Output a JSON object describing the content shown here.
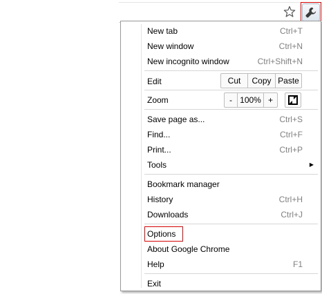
{
  "toolbar": {
    "star_icon": "star-icon",
    "wrench_icon": "wrench-icon",
    "highlight_color": "#d40000"
  },
  "menu": {
    "new_tab": {
      "label": "New tab",
      "shortcut": "Ctrl+T"
    },
    "new_window": {
      "label": "New window",
      "shortcut": "Ctrl+N"
    },
    "new_incognito": {
      "label": "New incognito window",
      "shortcut": "Ctrl+Shift+N"
    },
    "edit": {
      "label": "Edit",
      "cut": "Cut",
      "copy": "Copy",
      "paste": "Paste"
    },
    "zoom": {
      "label": "Zoom",
      "minus": "-",
      "level": "100%",
      "plus": "+"
    },
    "save_page": {
      "label": "Save page as...",
      "shortcut": "Ctrl+S"
    },
    "find": {
      "label": "Find...",
      "shortcut": "Ctrl+F"
    },
    "print": {
      "label": "Print...",
      "shortcut": "Ctrl+P"
    },
    "tools": {
      "label": "Tools"
    },
    "bookmark_manager": {
      "label": "Bookmark manager"
    },
    "history": {
      "label": "History",
      "shortcut": "Ctrl+H"
    },
    "downloads": {
      "label": "Downloads",
      "shortcut": "Ctrl+J"
    },
    "options": {
      "label": "Options"
    },
    "about": {
      "label": "About Google Chrome"
    },
    "help": {
      "label": "Help",
      "shortcut": "F1"
    },
    "exit": {
      "label": "Exit"
    }
  }
}
